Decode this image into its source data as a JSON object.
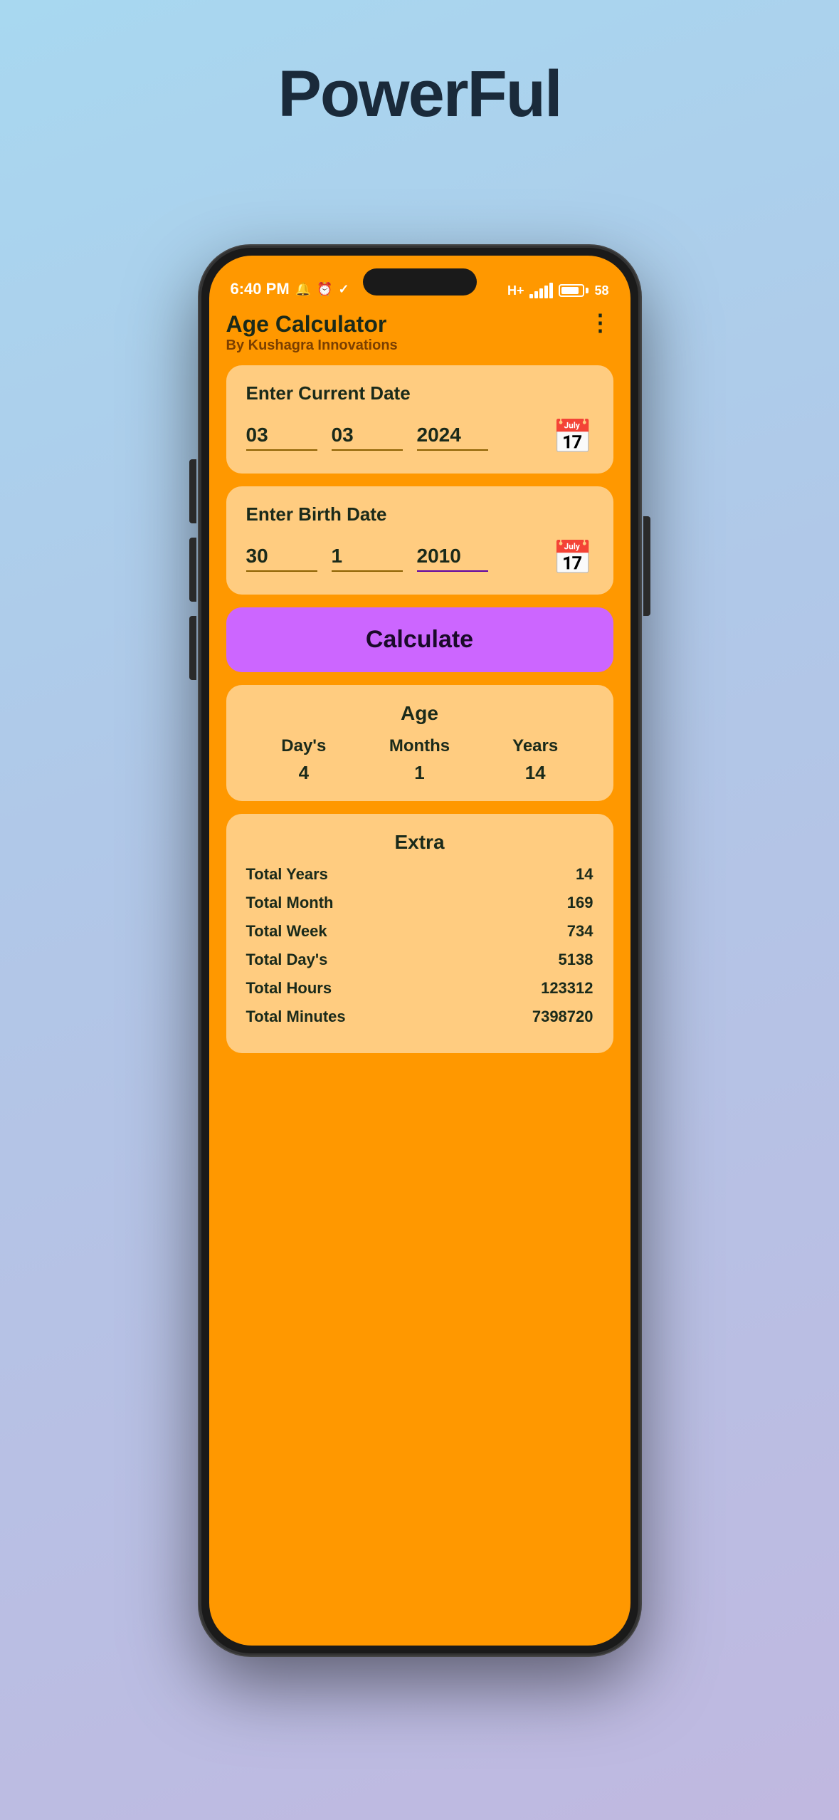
{
  "page": {
    "title": "PowerFul",
    "background_start": "#a8d8f0",
    "background_end": "#c0b8e0"
  },
  "status_bar": {
    "time": "6:40 PM",
    "signal": "H+",
    "battery": "58"
  },
  "app": {
    "title": "Age Calculator",
    "subtitle": "By Kushagra Innovations",
    "menu_label": "⋮"
  },
  "current_date_card": {
    "title": "Enter Current Date",
    "day": "03",
    "month": "03",
    "year": "2024"
  },
  "birth_date_card": {
    "title": "Enter Birth Date",
    "day": "30",
    "month": "1",
    "year": "2010"
  },
  "calculate_button": {
    "label": "Calculate"
  },
  "age_result": {
    "title": "Age",
    "days_label": "Day's",
    "months_label": "Months",
    "years_label": "Years",
    "days_value": "4",
    "months_value": "1",
    "years_value": "14"
  },
  "extra": {
    "title": "Extra",
    "rows": [
      {
        "label": "Total  Years",
        "value": "14"
      },
      {
        "label": "Total Month",
        "value": "169"
      },
      {
        "label": "Total Week",
        "value": "734"
      },
      {
        "label": "Total Day's",
        "value": "5138"
      },
      {
        "label": "Total Hours",
        "value": "123312"
      },
      {
        "label": "Total Minutes",
        "value": "7398720"
      }
    ]
  }
}
